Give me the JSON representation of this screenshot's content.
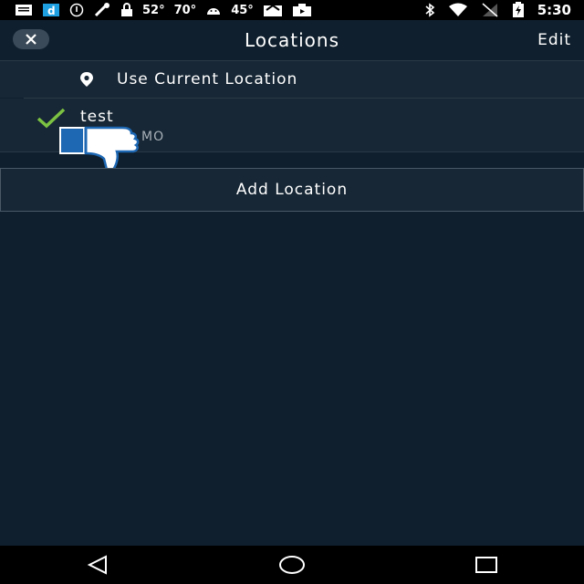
{
  "status_bar": {
    "time": "5:30",
    "temp1": "52°",
    "temp2": "70°",
    "temp3": "45°"
  },
  "header": {
    "title": "Locations",
    "edit_label": "Edit"
  },
  "locations": {
    "current_location_label": "Use Current Location",
    "items": [
      {
        "name": "test",
        "sub": "MO",
        "selected": true
      }
    ]
  },
  "add_location_label": "Add Location",
  "colors": {
    "background": "#0f1f2d",
    "row": "#172735",
    "check": "#7cc242",
    "thumb_blue": "#1d67b3"
  }
}
